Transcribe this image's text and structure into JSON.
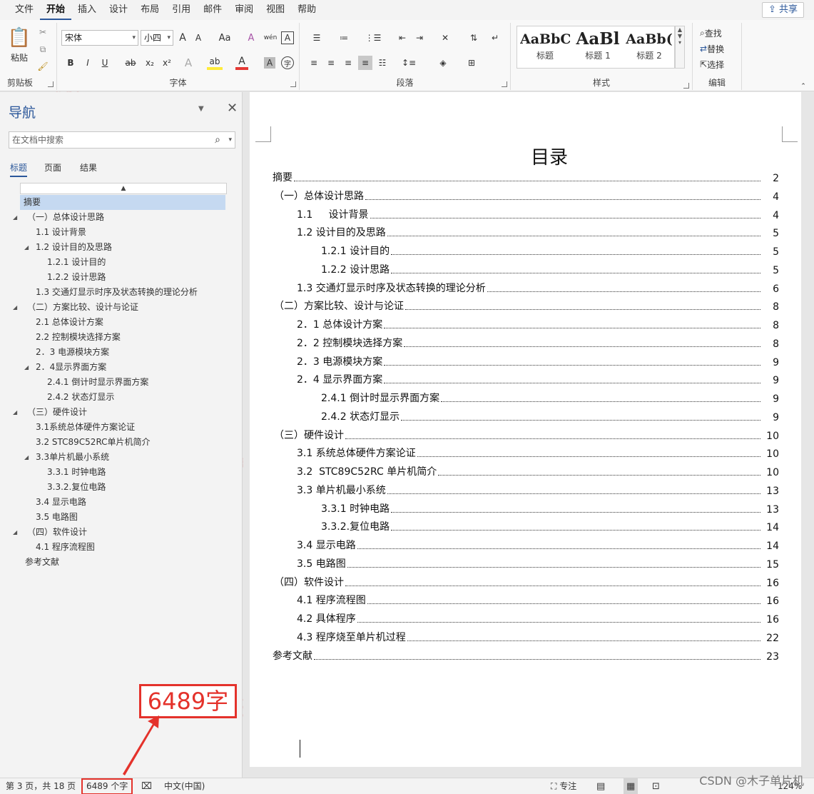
{
  "menu": {
    "items": [
      "文件",
      "开始",
      "插入",
      "设计",
      "布局",
      "引用",
      "邮件",
      "审阅",
      "视图",
      "帮助"
    ],
    "active": "开始",
    "share": "共享"
  },
  "ribbon": {
    "clipboard": {
      "paste": "粘贴",
      "label": "剪贴板"
    },
    "font": {
      "font_name": "宋体",
      "font_size": "小四",
      "grow": "A",
      "shrink": "A",
      "case": "Aa",
      "clear": "A",
      "phonetic": "wén",
      "border_char": "A",
      "bold": "B",
      "italic": "I",
      "underline": "U",
      "strike": "ab",
      "subscript": "x₂",
      "superscript": "x²",
      "effects": "A",
      "highlight": "ab",
      "font_color": "A",
      "shading": "A",
      "enclose": "字",
      "label": "字体"
    },
    "paragraph": {
      "label": "段落"
    },
    "styles": {
      "items": [
        {
          "preview": "AaBbC",
          "name": "标题"
        },
        {
          "preview": "AaBl",
          "name": "标题 1"
        },
        {
          "preview": "AaBb(",
          "name": "标题 2"
        }
      ],
      "label": "样式"
    },
    "editing": {
      "find": "查找",
      "replace": "替换",
      "select": "选择",
      "label": "编辑"
    },
    "accent": "#2b579a"
  },
  "nav": {
    "title": "导航",
    "search_placeholder": "在文档中搜索",
    "tabs": [
      "标题",
      "页面",
      "结果"
    ],
    "active_tab": "标题",
    "items": [
      {
        "label": "摘要",
        "level": 0,
        "selected": true
      },
      {
        "label": "（一）总体设计思路",
        "level": 0,
        "expanded": true
      },
      {
        "label": "1.1 设计背景",
        "level": 1
      },
      {
        "label": "1.2 设计目的及思路",
        "level": 1,
        "expanded": true
      },
      {
        "label": "1.2.1 设计目的",
        "level": 2
      },
      {
        "label": "1.2.2 设计思路",
        "level": 2
      },
      {
        "label": "1.3 交通灯显示时序及状态转换的理论分析",
        "level": 1
      },
      {
        "label": "（二）方案比较、设计与论证",
        "level": 0,
        "expanded": true
      },
      {
        "label": "2.1  总体设计方案",
        "level": 1
      },
      {
        "label": "2.2 控制模块选择方案",
        "level": 1
      },
      {
        "label": "2．3 电源模块方案",
        "level": 1
      },
      {
        "label": "2．4显示界面方案",
        "level": 1,
        "expanded": true
      },
      {
        "label": "2.4.1 倒计时显示界面方案",
        "level": 2
      },
      {
        "label": "2.4.2 状态灯显示",
        "level": 2
      },
      {
        "label": "（三）硬件设计",
        "level": 0,
        "expanded": true
      },
      {
        "label": "3.1系统总体硬件方案论证",
        "level": 1
      },
      {
        "label": "3.2  STC89C52RC单片机简介",
        "level": 1
      },
      {
        "label": "3.3单片机最小系统",
        "level": 1,
        "expanded": true
      },
      {
        "label": "3.3.1 时钟电路",
        "level": 2
      },
      {
        "label": "3.3.2.复位电路",
        "level": 2
      },
      {
        "label": "3.4 显示电路",
        "level": 1
      },
      {
        "label": "3.5 电路图",
        "level": 1
      },
      {
        "label": "（四）软件设计",
        "level": 0,
        "expanded": true
      },
      {
        "label": "4.1 程序流程图",
        "level": 1
      },
      {
        "label": "参考文献",
        "level": 0
      }
    ]
  },
  "document": {
    "toc_title": "目录",
    "toc": [
      {
        "text": "摘要",
        "page": "2",
        "indent": 0
      },
      {
        "text": "（一）总体设计思路",
        "page": "4",
        "indent": 0
      },
      {
        "text": "1.1     设计背景",
        "page": "4",
        "indent": 1
      },
      {
        "text": "1.2 设计目的及思路",
        "page": "5",
        "indent": 1
      },
      {
        "text": "1.2.1 设计目的",
        "page": "5",
        "indent": 2
      },
      {
        "text": "1.2.2 设计思路",
        "page": "5",
        "indent": 2
      },
      {
        "text": "1.3 交通灯显示时序及状态转换的理论分析",
        "page": "6",
        "indent": 1
      },
      {
        "text": "（二）方案比较、设计与论证",
        "page": "8",
        "indent": 0
      },
      {
        "text": "2．1 总体设计方案",
        "page": "8",
        "indent": 1
      },
      {
        "text": "2．2 控制模块选择方案",
        "page": "8",
        "indent": 1
      },
      {
        "text": "2．3 电源模块方案",
        "page": "9",
        "indent": 1
      },
      {
        "text": "2．4 显示界面方案",
        "page": "9",
        "indent": 1
      },
      {
        "text": "2.4.1 倒计时显示界面方案",
        "page": "9",
        "indent": 2
      },
      {
        "text": "2.4.2 状态灯显示",
        "page": "9",
        "indent": 2
      },
      {
        "text": "（三）硬件设计",
        "page": "10",
        "indent": 0
      },
      {
        "text": "3.1 系统总体硬件方案论证",
        "page": "10",
        "indent": 1
      },
      {
        "text": "3.2  STC89C52RC 单片机简介",
        "page": "10",
        "indent": 1
      },
      {
        "text": "3.3 单片机最小系统",
        "page": "13",
        "indent": 1
      },
      {
        "text": "3.3.1 时钟电路",
        "page": "13",
        "indent": 2
      },
      {
        "text": "3.3.2.复位电路",
        "page": "14",
        "indent": 2
      },
      {
        "text": "3.4 显示电路",
        "page": "14",
        "indent": 1
      },
      {
        "text": "3.5 电路图",
        "page": "15",
        "indent": 1
      },
      {
        "text": "（四）软件设计",
        "page": "16",
        "indent": 0
      },
      {
        "text": "4.1 程序流程图",
        "page": "16",
        "indent": 1
      },
      {
        "text": "4.2 具体程序",
        "page": "16",
        "indent": 1
      },
      {
        "text": "4.3 程序烧至单片机过程",
        "page": "22",
        "indent": 1
      },
      {
        "text": "参考文献",
        "page": "23",
        "indent": 0
      }
    ]
  },
  "annotation": {
    "text": "6489字",
    "color": "#e4322b"
  },
  "status": {
    "page_info": "第 3 页，共 18 页",
    "word_count": "6489 个字",
    "language": "中文(中国)",
    "focus": "专注",
    "zoom": "124%"
  },
  "watermark": {
    "text": "木子单片机",
    "credit": "CSDN @木子单片机"
  }
}
